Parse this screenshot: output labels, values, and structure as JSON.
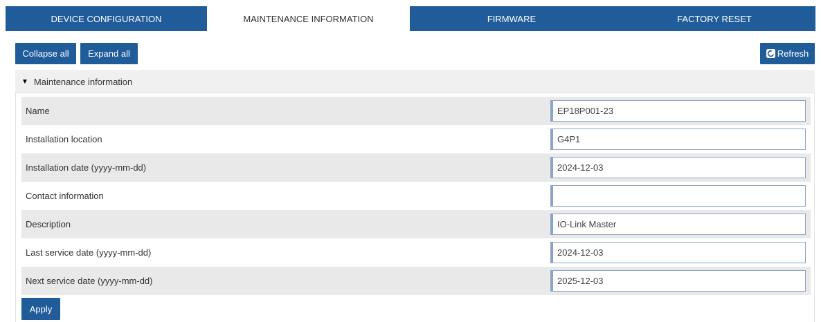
{
  "tabs": [
    {
      "label": "DEVICE CONFIGURATION"
    },
    {
      "label": "MAINTENANCE INFORMATION"
    },
    {
      "label": "FIRMWARE"
    },
    {
      "label": "FACTORY RESET"
    }
  ],
  "toolbar": {
    "collapse_label": "Collapse all",
    "expand_label": "Expand all",
    "refresh_label": "Refresh"
  },
  "section": {
    "title": "Maintenance information"
  },
  "fields": [
    {
      "label": "Name",
      "value": "EP18P001-23"
    },
    {
      "label": "Installation location",
      "value": "G4P1"
    },
    {
      "label": "Installation date (yyyy-mm-dd)",
      "value": "2024-12-03"
    },
    {
      "label": "Contact information",
      "value": ""
    },
    {
      "label": "Description",
      "value": "IO-Link Master"
    },
    {
      "label": "Last service date (yyyy-mm-dd)",
      "value": "2024-12-03"
    },
    {
      "label": "Next service date (yyyy-mm-dd)",
      "value": "2025-12-03"
    }
  ],
  "actions": {
    "apply_label": "Apply"
  },
  "icons": {
    "refresh": "refresh-icon",
    "caret": "caret-down-icon"
  },
  "colors": {
    "primary": "#1f5c99",
    "row_shade": "#e9e9e9",
    "field_border": "#8aa4c8"
  }
}
